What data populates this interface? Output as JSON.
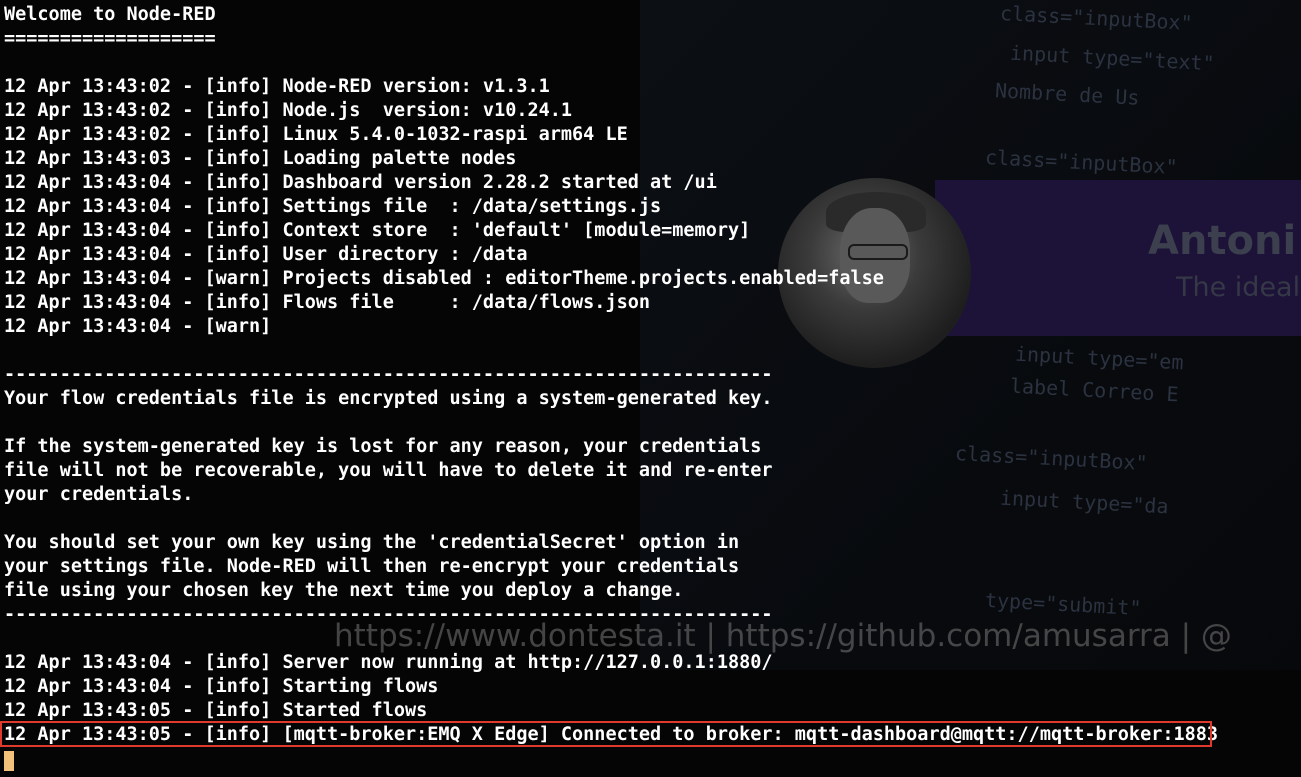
{
  "terminal": {
    "lines": [
      "Welcome to Node-RED",
      "===================",
      "",
      "12 Apr 13:43:02 - [info] Node-RED version: v1.3.1",
      "12 Apr 13:43:02 - [info] Node.js  version: v10.24.1",
      "12 Apr 13:43:02 - [info] Linux 5.4.0-1032-raspi arm64 LE",
      "12 Apr 13:43:03 - [info] Loading palette nodes",
      "12 Apr 13:43:04 - [info] Dashboard version 2.28.2 started at /ui",
      "12 Apr 13:43:04 - [info] Settings file  : /data/settings.js",
      "12 Apr 13:43:04 - [info] Context store  : 'default' [module=memory]",
      "12 Apr 13:43:04 - [info] User directory : /data",
      "12 Apr 13:43:04 - [warn] Projects disabled : editorTheme.projects.enabled=false",
      "12 Apr 13:43:04 - [info] Flows file     : /data/flows.json",
      "12 Apr 13:43:04 - [warn]",
      "",
      "---------------------------------------------------------------------",
      "Your flow credentials file is encrypted using a system-generated key.",
      "",
      "If the system-generated key is lost for any reason, your credentials",
      "file will not be recoverable, you will have to delete it and re-enter",
      "your credentials.",
      "",
      "You should set your own key using the 'credentialSecret' option in",
      "your settings file. Node-RED will then re-encrypt your credentials",
      "file using your chosen key the next time you deploy a change.",
      "---------------------------------------------------------------------",
      "",
      "12 Apr 13:43:04 - [info] Server now running at http://127.0.0.1:1880/",
      "12 Apr 13:43:04 - [info] Starting flows",
      "12 Apr 13:43:05 - [info] Started flows",
      "12 Apr 13:43:05 - [info] [mqtt-broker:EMQ X Edge] Connected to broker: mqtt-dashboard@mqtt://mqtt-broker:1883"
    ]
  },
  "background": {
    "watermark": "https://www.dontesta.it | https://github.com/amusarra | @",
    "banner_name": "Antoni",
    "banner_subtitle": "The ideal",
    "code_snippets": [
      "class=\"inputBox\"",
      "input type=\"text\"",
      "Nombre de Us",
      "class=\"inputBox\"",
      "input type=\"em",
      "label Correo E",
      "class=\"inputBox\"",
      "input type=\"da",
      "type=\"submit\""
    ]
  },
  "colors": {
    "text": "#ffffff",
    "highlight_border": "#e03a2f",
    "cursor": "#f3c27a",
    "background": "#050505"
  }
}
